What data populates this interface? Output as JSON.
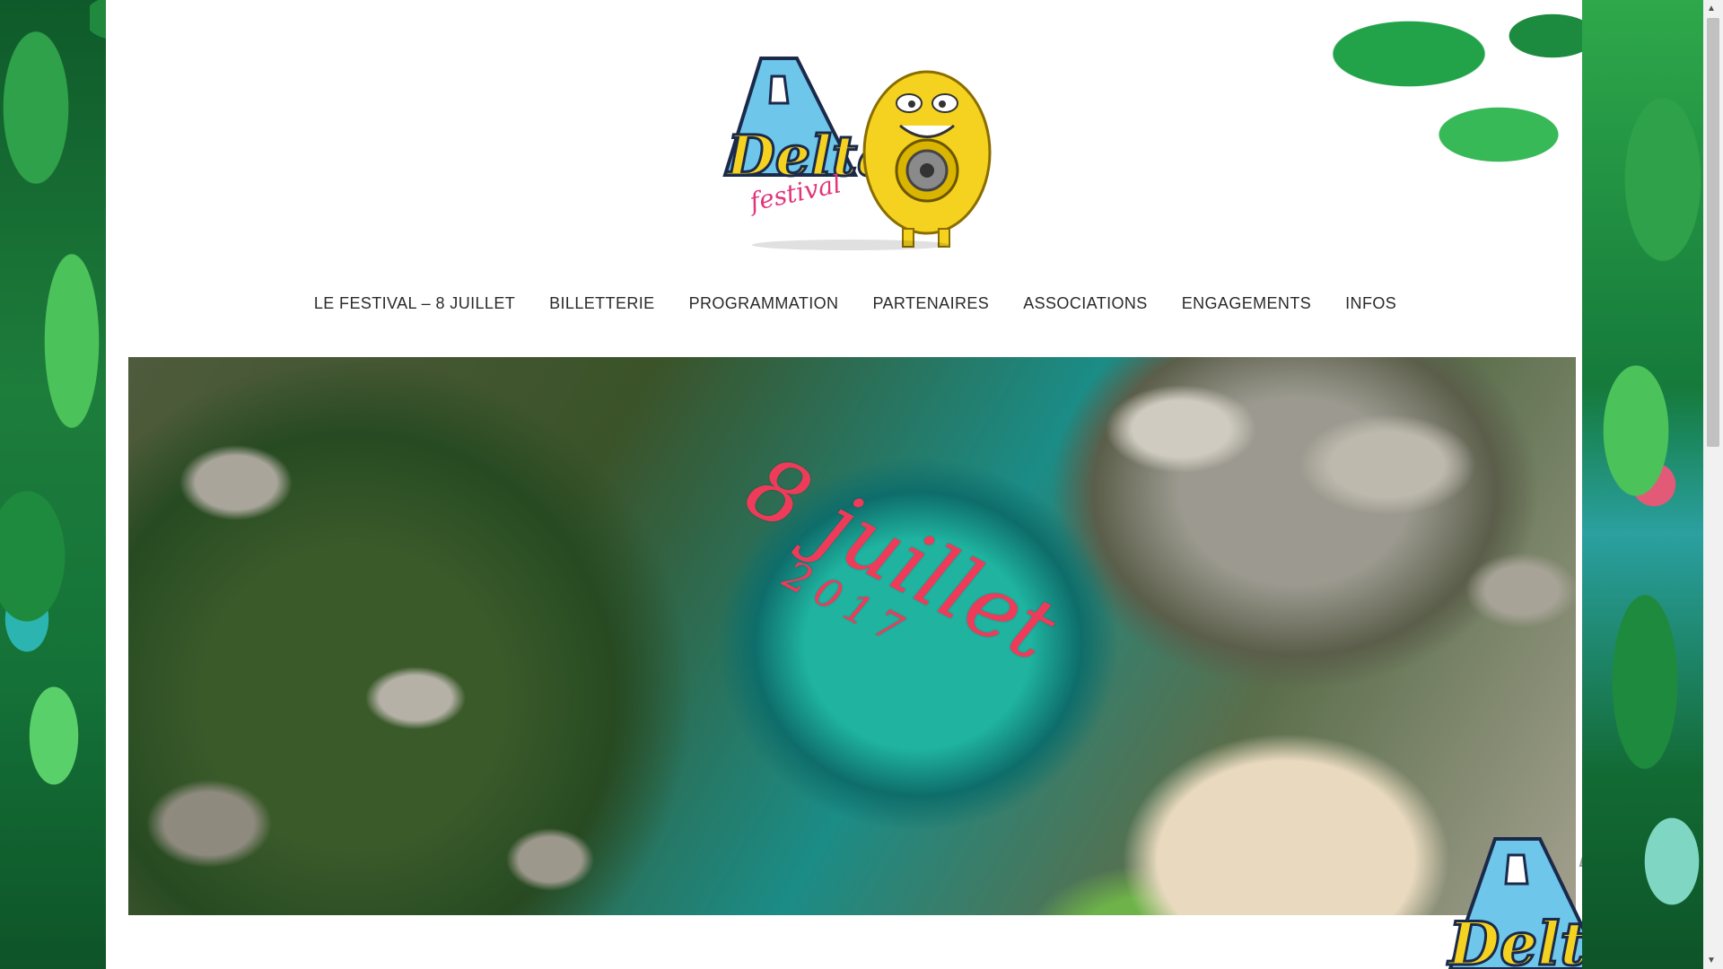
{
  "brand": {
    "logo_word": "Delta",
    "logo_sub": "festival"
  },
  "nav": {
    "items": [
      {
        "label": "LE FESTIVAL – 8 JUILLET"
      },
      {
        "label": "BILLETTERIE"
      },
      {
        "label": "PROGRAMMATION"
      },
      {
        "label": "PARTENAIRES"
      },
      {
        "label": "ASSOCIATIONS"
      },
      {
        "label": "ENGAGEMENTS"
      },
      {
        "label": "INFOS"
      }
    ]
  },
  "hero": {
    "date_line": "8 juillet",
    "year_line": "2017"
  },
  "corner_logo": {
    "word": "Delta"
  },
  "colors": {
    "accent": "#ef3b5a",
    "logo_blue": "#6ec6ea",
    "logo_yellow": "#f4d21f",
    "nav_text": "#2a2a2a"
  }
}
